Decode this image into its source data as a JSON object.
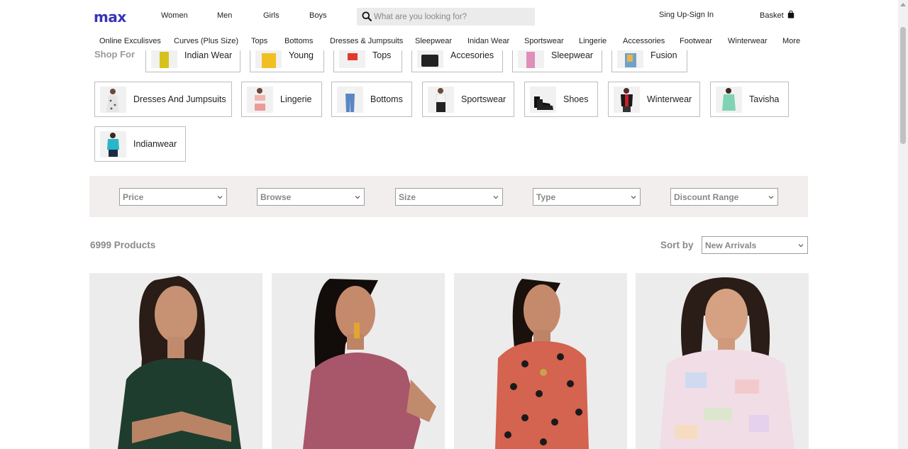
{
  "header": {
    "logo": "max",
    "nav": [
      "Women",
      "Men",
      "Girls",
      "Boys"
    ],
    "search_placeholder": "What are you looking for?",
    "signin": "Sing Up-Sign In",
    "basket": "Basket"
  },
  "category_nav": [
    "Online Exculisves",
    "Curves (Plus Size)",
    "Tops",
    "Bottoms",
    "Dresses & Jumpsuits",
    "Sleepwear",
    "Inidan Wear",
    "Sportswear",
    "Lingerie",
    "Accessories",
    "Footwear",
    "Winterwear",
    "More"
  ],
  "shop_for": {
    "heading": "Shop For",
    "row1": [
      "Indian Wear",
      "Young",
      "Tops",
      "Accesories",
      "Sleepwear",
      "Fusion"
    ],
    "row2": [
      "Dresses And Jumpsuits",
      "Lingerie",
      "Bottoms",
      "Sportswear",
      "Shoes",
      "Winterwear",
      "Tavisha"
    ],
    "row3": [
      "Indianwear"
    ]
  },
  "filters": [
    "Price",
    "Browse",
    "Size",
    "Type",
    "Discount Range"
  ],
  "results": {
    "count": "6999 Products",
    "sort_label": "Sort by",
    "sort_value": "New Arrivals"
  },
  "colors": {
    "brand": "#3636b8",
    "filter_bg": "#f3eeee",
    "product_bg": "#ececec"
  },
  "products": [
    {
      "garment": "green ribbed top",
      "color": "#1f3d2e"
    },
    {
      "garment": "mauve ribbed top",
      "color": "#a8566a"
    },
    {
      "garment": "rust polka dot dress",
      "color": "#d4634f"
    },
    {
      "garment": "pastel print tee",
      "color": "#f1dde6"
    }
  ]
}
